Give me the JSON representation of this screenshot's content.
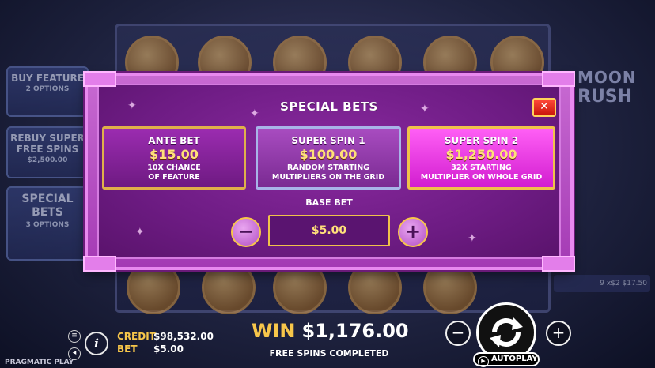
{
  "background": {
    "side_panels": [
      {
        "title": "BUY FEATURE",
        "subtitle": "2 OPTIONS"
      },
      {
        "title": "REBUY SUPER FREE SPINS",
        "subtitle": "$2,500.00"
      },
      {
        "title": "SPECIAL BETS",
        "subtitle": "3 OPTIONS"
      }
    ],
    "logo_line1": "MOON",
    "logo_line2": "RUSH",
    "right_strip_text": "9 x$2 $17.50"
  },
  "modal": {
    "title": "SPECIAL BETS",
    "close_label": "✕",
    "options": [
      {
        "name": "ANTE BET",
        "price": "$15.00",
        "desc_line1": "10X CHANCE",
        "desc_line2": "OF FEATURE"
      },
      {
        "name": "SUPER SPIN 1",
        "price": "$100.00",
        "desc_line1": "RANDOM STARTING",
        "desc_line2": "MULTIPLIERS ON THE GRID"
      },
      {
        "name": "SUPER SPIN 2",
        "price": "$1,250.00",
        "desc_line1": "32X STARTING",
        "desc_line2": "MULTIPLIER ON WHOLE GRID"
      }
    ],
    "base_bet_label": "BASE BET",
    "base_bet_value": "$5.00",
    "minus_label": "−",
    "plus_label": "+"
  },
  "footer": {
    "credit_label": "CREDIT",
    "credit_value": "$98,532.00",
    "bet_label": "BET",
    "bet_value": "$5.00",
    "win_label": "WIN",
    "win_value": "$1,176.00",
    "win_status": "FREE SPINS COMPLETED",
    "minus_label": "−",
    "plus_label": "+",
    "autoplay_label": "AUTOPLAY",
    "brand": "PRAGMATIC PLAY",
    "info_label": "i"
  },
  "colors": {
    "accent_gold": "#f7c64a",
    "modal_purple": "#6e1c84",
    "super_spin_2_pink": "#ff5ff5"
  }
}
